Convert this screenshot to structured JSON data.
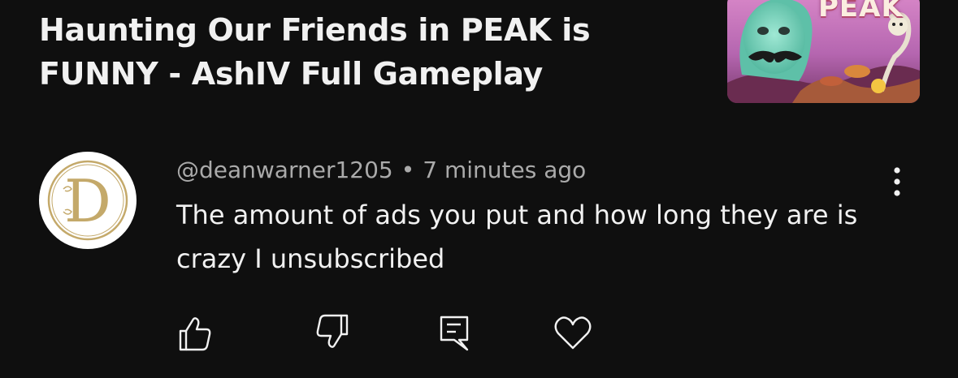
{
  "video": {
    "title": "Haunting Our Friends in PEAK is FUNNY - AshIV Full Gameplay",
    "thumbnail": {
      "logo_text": "PEAK"
    }
  },
  "comment": {
    "author_handle": "@deanwarner1205",
    "separator": "•",
    "timestamp": "7 minutes ago",
    "text": "The amount of ads you put and how long they are is crazy I unsubscribed",
    "avatar_letter": "D"
  },
  "actions": [
    {
      "icon": "thumbs-up-icon"
    },
    {
      "icon": "thumbs-down-icon"
    },
    {
      "icon": "reply-icon"
    },
    {
      "icon": "heart-icon"
    }
  ],
  "colors": {
    "background": "#0f0f0f",
    "primary_text": "#f1f1f1",
    "secondary_text": "#aaaaaa",
    "avatar_gold": "#c4a96a"
  }
}
